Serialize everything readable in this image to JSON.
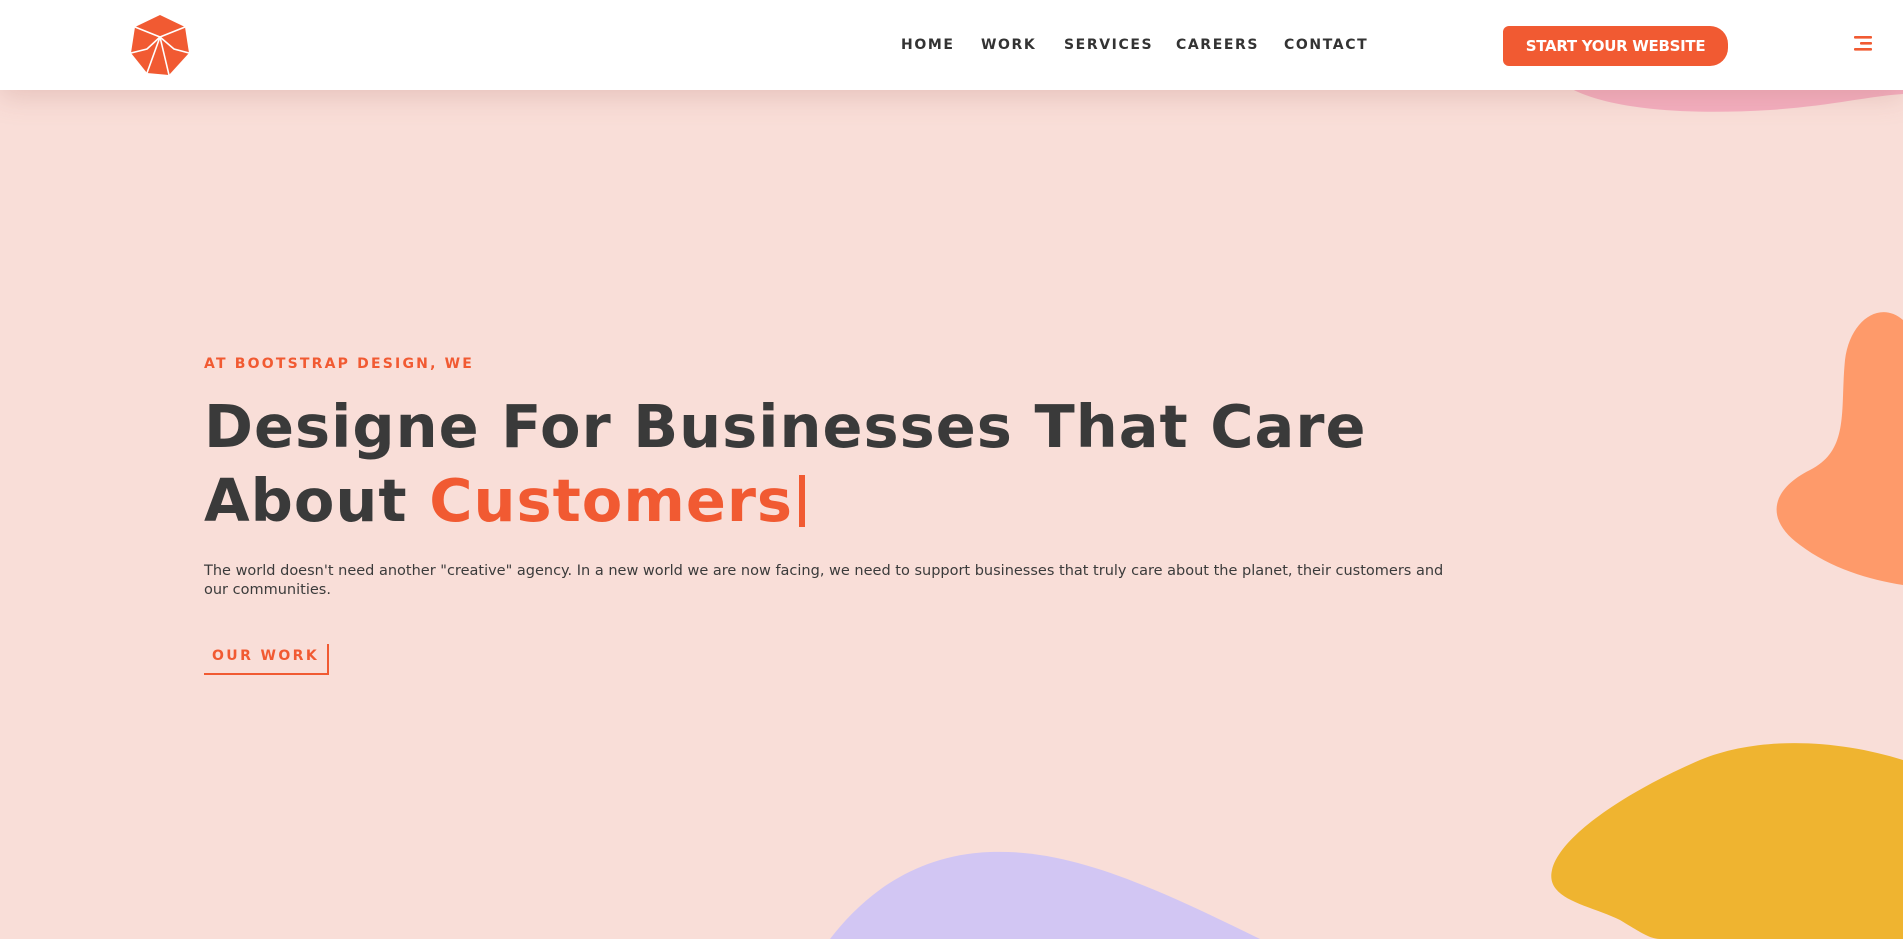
{
  "colors": {
    "accent": "#f15a32",
    "background": "#f9ded8",
    "heading": "#3a3a3a",
    "blob_pink": "#f4aebf",
    "blob_orange": "#fe9a6a",
    "blob_yellow": "#efb430",
    "blob_purple": "#d2c6f3"
  },
  "header": {
    "logo_icon": "geometric-cube-logo",
    "nav": {
      "home": "HOME",
      "work": "WORK",
      "services": "SERVICES",
      "careers": "CAREERS",
      "contact": "CONTACT"
    },
    "cta_label": "START YOUR WEBSITE",
    "menu_icon": "hamburger-menu-icon"
  },
  "hero": {
    "eyebrow": "AT BOOTSTRAP DESIGN, WE",
    "headline_line1": "Designe For Businesses That Care",
    "headline_line2_prefix": "About ",
    "headline_accent": "Customers",
    "description": "The world doesn't need another \"creative\" agency. In a new world we are now facing, we need to support businesses that truly care about the planet, their customers and our communities.",
    "cta_link": "OUR WORK"
  }
}
